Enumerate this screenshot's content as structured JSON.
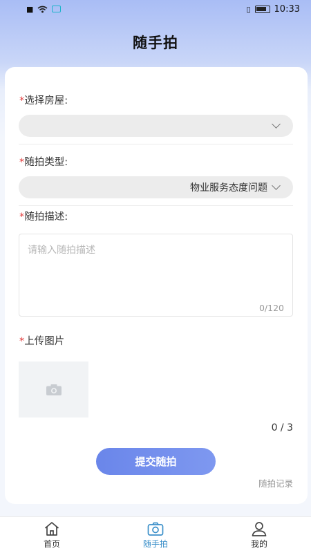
{
  "status_bar": {
    "time": "10:33"
  },
  "header": {
    "title": "随手拍"
  },
  "form": {
    "house": {
      "required_mark": "*",
      "label": "选择房屋:",
      "value": ""
    },
    "type": {
      "required_mark": "*",
      "label": "随拍类型:",
      "value": "物业服务态度问题"
    },
    "description": {
      "required_mark": "*",
      "label": "随拍描述:",
      "placeholder": "请输入随拍描述",
      "counter": "0/120"
    },
    "upload": {
      "required_mark": "*",
      "label": "上传图片",
      "counter": "0 / 3"
    },
    "submit_label": "提交随拍",
    "record_link": "随拍记录"
  },
  "tabbar": {
    "items": [
      {
        "label": "首页",
        "icon": "home-icon",
        "active": false
      },
      {
        "label": "随手拍",
        "icon": "camera-icon",
        "active": true
      },
      {
        "label": "我的",
        "icon": "user-icon",
        "active": false
      }
    ]
  },
  "colors": {
    "accent": "#6a86ea",
    "active_tab": "#3a8fc9",
    "required": "#e23b3b"
  }
}
